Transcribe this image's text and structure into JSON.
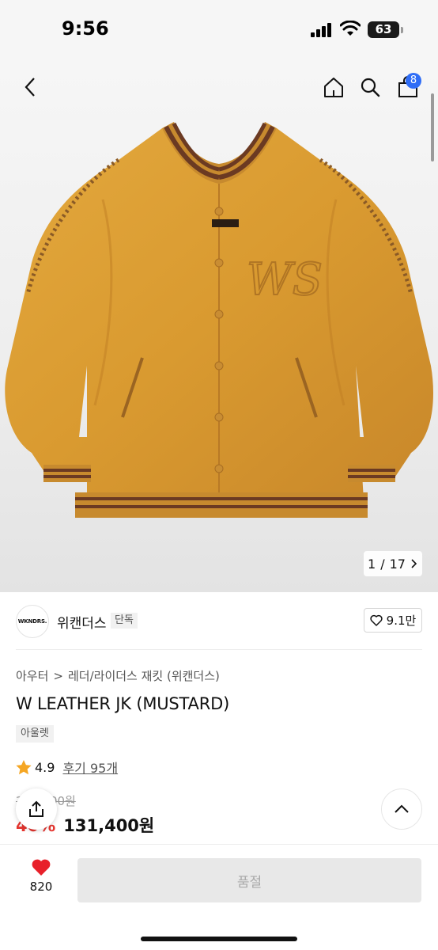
{
  "status_bar": {
    "time": "9:56",
    "battery": "63"
  },
  "header": {
    "back_icon": "chevron-left-icon",
    "home_icon": "home-icon",
    "search_icon": "search-icon",
    "cart_icon": "shopping-bag-icon",
    "cart_count": "8"
  },
  "gallery": {
    "current": "1",
    "separator": "/",
    "total": "17",
    "next_icon": "chevron-right-icon"
  },
  "brand": {
    "logo_text": "WKNDRS.",
    "name": "위캔더스",
    "tag": "단독",
    "like_count": "9.1만"
  },
  "breadcrumb": {
    "level1": "아우터",
    "separator": ">",
    "level2": "레더/라이더스 재킷 (위캔더스)"
  },
  "product": {
    "title": "W LEATHER JK (MUSTARD)",
    "badge": "아울렛",
    "rating": "4.9",
    "reviews": "후기 95개",
    "original_price": "219,000원",
    "discount": "40%",
    "price": "131,400원"
  },
  "bottom_bar": {
    "heart_count": "820",
    "buy_label": "품절"
  },
  "colors": {
    "accent_blue": "#2f6df6",
    "discount_red": "#e5352f",
    "heart_red": "#e8202a",
    "star_orange": "#f5a623",
    "jacket_mustard": "#d99a30",
    "stripe_brown": "#6b3a22"
  }
}
